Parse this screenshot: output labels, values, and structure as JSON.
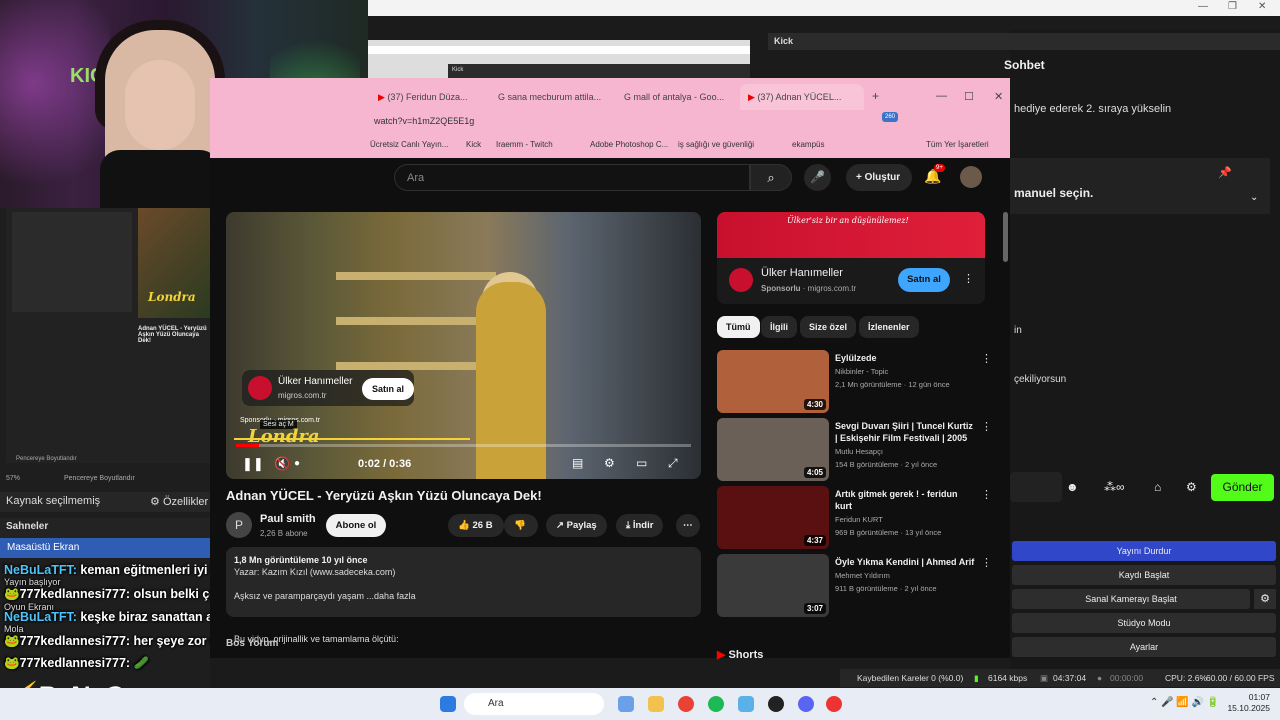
{
  "obs": {
    "right_header": "Kick",
    "chat_title": "Sohbet",
    "chat_line1": "hediye ederek 2. sıraya yükselin",
    "chat_line2": "manuel seçin.",
    "chat_line3": "in",
    "chat_line4": "çekiliyorsun",
    "send_label": "Gönder",
    "buttons": [
      "Yayını Durdur",
      "Kaydı Başlat",
      "Sanal Kamerayı Başlat",
      "Stüdyo Modu",
      "Ayarlar"
    ],
    "source_label": "Kaynak seçilmemiş",
    "properties_label": "Özellikler",
    "scenes_label": "Sahneler",
    "scene_item": "Masaüstü Ekran",
    "zoom": "57%",
    "fit_label": "Pencereye Boyutlandır",
    "status": {
      "dropped": "Kaybedilen Kareler 0 (%0.0)",
      "bitrate": "6164 kbps",
      "live_time": "04:37:04",
      "rec_time": "00:00:00",
      "cpu": "CPU: 2.6%",
      "fps": "60.00 / 60.00 FPS"
    }
  },
  "overlay": {
    "webcam_sign": "KICK",
    "chat": [
      {
        "user": "NeBuLaTFT:",
        "msg": " keman eğitmenleri iyi kazanıyor he",
        "sub": "Yayın başlıyor"
      },
      {
        "user": "777kedlannesi777:",
        "msg": " olsun belki çok seveceksin",
        "sub": "Oyun Ekranı"
      },
      {
        "user": "NeBuLaTFT:",
        "msg": " keşke biraz sanattan anlasaydım",
        "sub": "Mola"
      },
      {
        "user": "777kedlannesi777:",
        "msg": " her şeye zor diyip kenara çekiliyorsun",
        "sub": ""
      },
      {
        "user": "777kedlannesi777:",
        "msg": " 🥒",
        "sub": ""
      }
    ],
    "brand_by": "By",
    "brand_rest": "NoGame"
  },
  "chrome": {
    "tabs": [
      "(37) Feridun Düza...",
      "sana mecburum attila...",
      "mall of antalya - Goo...",
      "(37) Adnan YÜCEL..."
    ],
    "url": "watch?v=h1mZ2QE5E1g",
    "bookmarks": [
      "Ücretsiz Canlı Yayın...",
      "Kick",
      "Iraemm - Twitch",
      "Adobe Photoshop C...",
      "iş sağlığı ve güvenliği",
      "ekampüs",
      "Tüm Yer İşaretleri"
    ],
    "ext_badge": "260"
  },
  "youtube": {
    "search_placeholder": "Ara",
    "create_label": "Oluştur",
    "notif_badge": "9+",
    "video": {
      "ad_title": "Ülker Hanımeller",
      "ad_domain": "migros.com.tr",
      "buy_label": "Satın al",
      "overlay_text": "Londra",
      "time": "0:02 / 0:36",
      "mute_tip": "Sesi aç",
      "mute_key": "M",
      "sponsor": "Sponsorlu · migros.com.tr"
    },
    "title": "Adnan YÜCEL - Yeryüzü Aşkın Yüzü Oluncaya Dek!",
    "channel": "Paul smith",
    "subs": "2,26 B abone",
    "subscribe": "Abone ol",
    "likes": "26 B",
    "share": "Paylaş",
    "download": "İndir",
    "desc_meta": "1,8 Mn görüntüleme  10 yıl önce",
    "desc_line1": "Yazar: Kazım Kızıl (www.sadeceka.com)",
    "desc_line2": "Aşksız ve parampar­çaydı yaşam ...daha fazla",
    "desc_line3": "Bu vidyo, orijinallik ve tamamlama ölçütü:",
    "desc_line4": "Bos Yorum",
    "sidebar_ad": {
      "banner": "Ülker'siz bir an düşünülemez!",
      "title": "Ülker Hanımeller",
      "sponsor": "Sponsorlu",
      "domain": "migros.com.tr",
      "buy": "Satın al"
    },
    "chips": [
      "Tümü",
      "İlgili",
      "Size özel",
      "İzlenenler"
    ],
    "recommendations": [
      {
        "title": "Eylülzede",
        "channel": "Nikbinler - Topic",
        "meta": "2,1 Mn görüntüleme · 12 gün önce",
        "duration": "4:30",
        "color": "#b0603a"
      },
      {
        "title": "Sevgi Duvarı Şiiri | Tuncel Kurtiz | Eskişehir Film Festivali | 2005",
        "channel": "Mutlu Hesapçı",
        "meta": "154 B görüntüleme · 2 yıl önce",
        "duration": "4:05",
        "color": "#6a6058"
      },
      {
        "title": "Artık gitmek gerek ! - feridun kurt",
        "channel": "Feridun KURT",
        "meta": "969 B görüntüleme · 13 yıl önce",
        "duration": "4:37",
        "color": "#5a1010"
      },
      {
        "title": "Öyle Yıkma Kendini | Ahmed Arif",
        "channel": "Mehmet Yıldırım",
        "meta": "911 B görüntüleme · 2 yıl önce",
        "duration": "3:07",
        "color": "#3a3a3a"
      }
    ],
    "shorts": "Shorts"
  },
  "taskbar": {
    "search": "Ara",
    "time": "01:07",
    "date": "15.10.2025"
  }
}
